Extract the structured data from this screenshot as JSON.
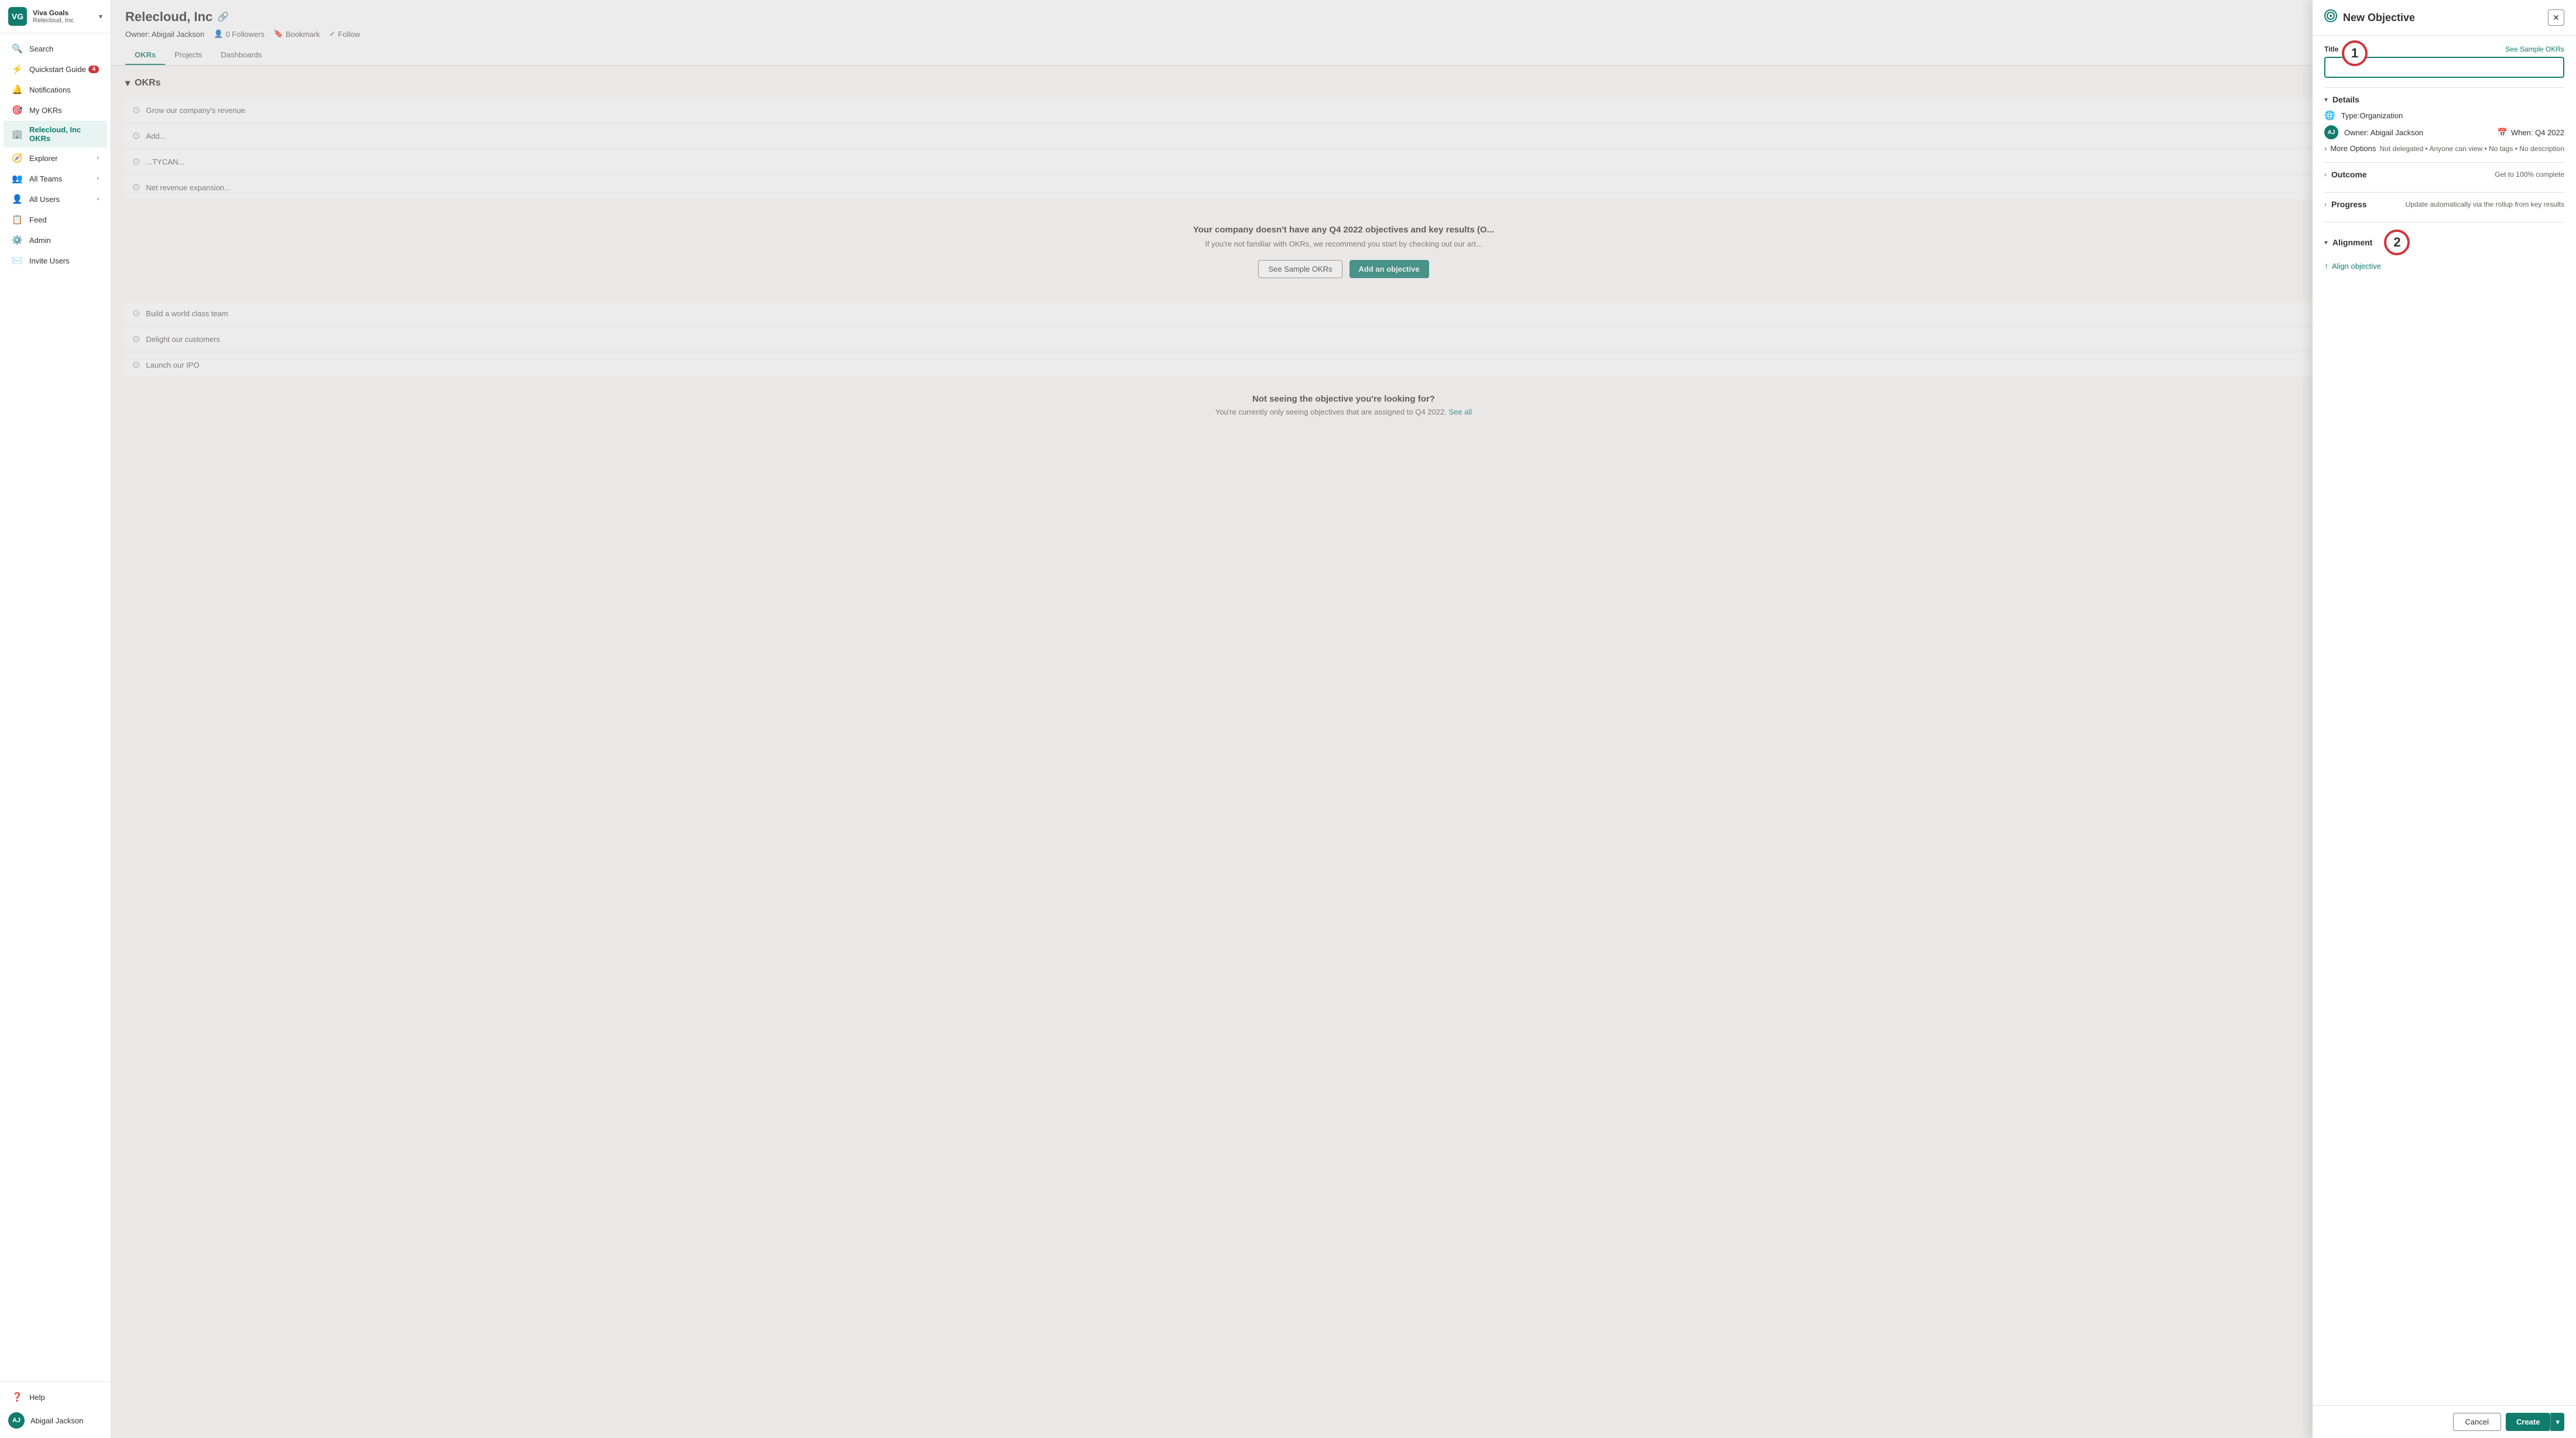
{
  "app": {
    "title": "Viva Goals",
    "org": "Relecloud, Inc",
    "logo_initials": "VG"
  },
  "sidebar": {
    "items": [
      {
        "id": "search",
        "label": "Search",
        "icon": "🔍",
        "badge": null,
        "chevron": false,
        "active": false
      },
      {
        "id": "quickstart",
        "label": "Quickstart Guide",
        "icon": "⚡",
        "badge": "4",
        "chevron": false,
        "active": false
      },
      {
        "id": "notifications",
        "label": "Notifications",
        "icon": "🔔",
        "badge": null,
        "chevron": false,
        "active": false
      },
      {
        "id": "myokrs",
        "label": "My OKRs",
        "icon": "🎯",
        "badge": null,
        "chevron": false,
        "active": false
      },
      {
        "id": "relecloud",
        "label": "Relecloud, Inc OKRs",
        "icon": "🏢",
        "badge": null,
        "chevron": false,
        "active": true
      },
      {
        "id": "explorer",
        "label": "Explorer",
        "icon": "🧭",
        "badge": null,
        "chevron": true,
        "active": false
      },
      {
        "id": "allteams",
        "label": "All Teams",
        "icon": "👥",
        "badge": null,
        "chevron": true,
        "active": false
      },
      {
        "id": "allusers",
        "label": "All Users",
        "icon": "👤",
        "badge": null,
        "chevron": true,
        "active": false
      },
      {
        "id": "feed",
        "label": "Feed",
        "icon": "📋",
        "badge": null,
        "chevron": false,
        "active": false
      },
      {
        "id": "admin",
        "label": "Admin",
        "icon": "⚙️",
        "badge": null,
        "chevron": false,
        "active": false
      },
      {
        "id": "invite",
        "label": "Invite Users",
        "icon": "✉️",
        "badge": null,
        "chevron": false,
        "active": false
      }
    ],
    "bottom_items": [
      {
        "id": "help",
        "label": "Help",
        "icon": "❓",
        "active": false
      }
    ],
    "user": {
      "name": "Abigail Jackson",
      "initials": "AJ"
    }
  },
  "main": {
    "title": "Relecloud, Inc",
    "owner": "Owner: Abigail Jackson",
    "followers": "0 Followers",
    "bookmark_label": "Bookmark",
    "follow_label": "Follow",
    "tabs": [
      {
        "id": "okrs",
        "label": "OKRs",
        "active": true
      },
      {
        "id": "projects",
        "label": "Projects",
        "active": false
      },
      {
        "id": "dashboards",
        "label": "Dashboards",
        "active": false
      }
    ],
    "section_title": "OKRs",
    "okr_items": [
      {
        "label": "Grow our company's revenue"
      },
      {
        "label": "Add..."
      },
      {
        "label": "...TYCAN..."
      },
      {
        "label": "Net revenue expansion..."
      }
    ],
    "okr_items2": [
      {
        "label": "Build a world class team"
      },
      {
        "label": "Delight our customers"
      },
      {
        "label": "Launch our IPO"
      }
    ],
    "empty_state": {
      "title": "Your company doesn't have any Q4 2022 objectives and key results (O...",
      "sub": "If you're not familiar with OKRs, we recommend you start by checking out our art...",
      "btn_sample": "See Sample OKRs",
      "btn_add": "Add an objective"
    },
    "not_seeing": {
      "title": "Not seeing the objective you're looking for?",
      "sub": "You're currently only seeing objectives that are assigned to Q4 2022.",
      "link": "See all"
    }
  },
  "panel": {
    "title": "New Objective",
    "icon": "🎯",
    "sample_link": "See Sample OKRs",
    "title_field_label": "Title",
    "title_placeholder": "",
    "details": {
      "section_label": "Details",
      "type_label": "Type:Organization",
      "owner_label": "Owner: Abigail Jackson",
      "owner_initials": "AJ",
      "when_label": "When: Q4 2022",
      "more_options_label": "More Options",
      "more_meta": "Not delegated • Anyone can view • No tags • No description"
    },
    "outcome": {
      "section_label": "Outcome",
      "note": "Get to 100% complete"
    },
    "progress": {
      "section_label": "Progress",
      "note": "Update automatically via the rollup from key results"
    },
    "alignment": {
      "section_label": "Alignment",
      "align_link": "Align objective"
    },
    "footer": {
      "cancel_label": "Cancel",
      "create_label": "Create"
    },
    "annotation1": "1",
    "annotation2": "2"
  }
}
